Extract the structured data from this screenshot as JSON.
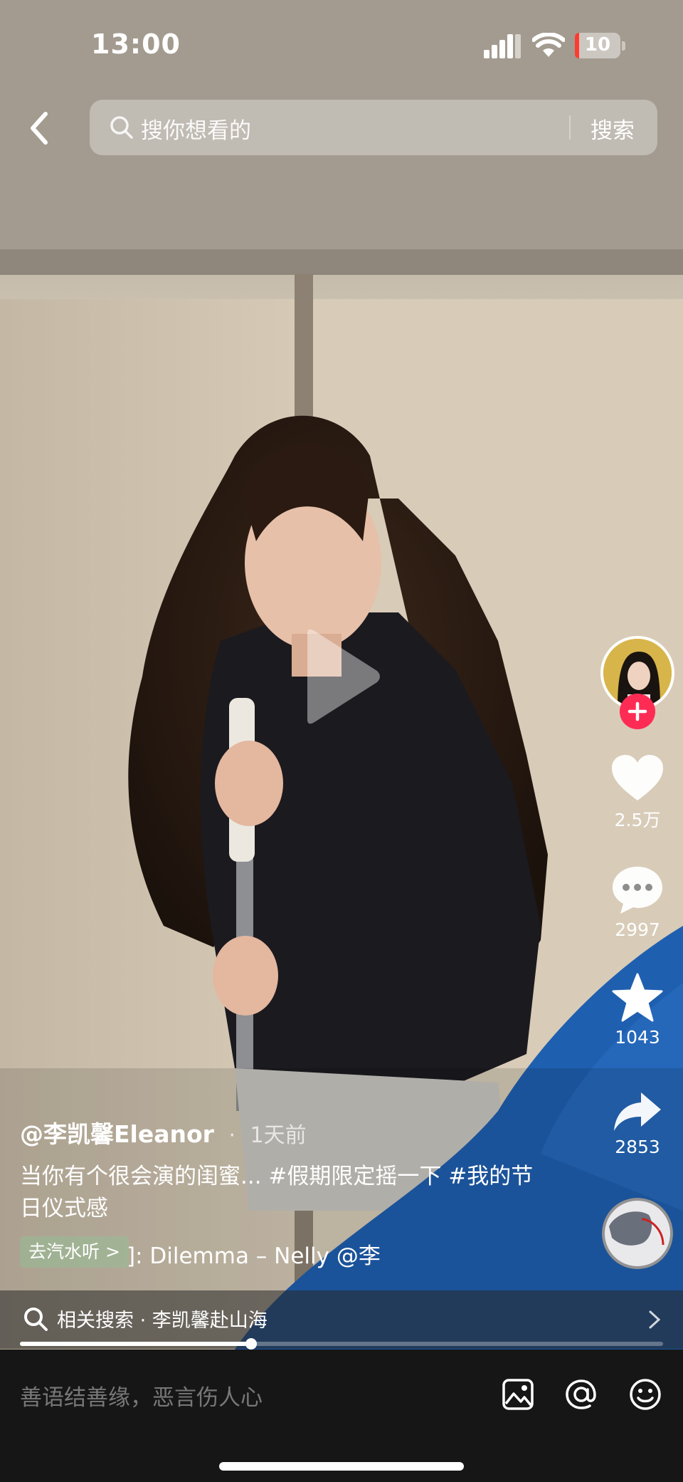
{
  "status_bar": {
    "time": "13:00",
    "battery_text": "10",
    "battery_level_percent": 10,
    "battery_color": "#ff3b30"
  },
  "search": {
    "placeholder": "搜你想看的",
    "button_label": "搜索"
  },
  "actions": {
    "likes": "2.5万",
    "comments": "2997",
    "favorites": "1043",
    "shares": "2853",
    "follow_color": "#fe2c55"
  },
  "post": {
    "author": "@李凯馨Eleanor",
    "separator": "·",
    "time": "1天前",
    "description": "当你有个很会演的闺蜜... #假期限定摇一下 #我的节日仪式感",
    "music_chip": "去汽水听 >",
    "music": "]: Dilemma – Nelly    @李"
  },
  "related": {
    "text": "相关搜索 · 李凯馨赴山海"
  },
  "progress": {
    "fraction": 0.36
  },
  "comment_bar": {
    "placeholder": "善语结善缘，恶言伤人心"
  },
  "icons": [
    "back-arrow-icon",
    "search-icon",
    "play-icon",
    "heart-icon",
    "comment-icon",
    "star-icon",
    "share-icon",
    "image-icon",
    "at-icon",
    "emoji-icon"
  ]
}
